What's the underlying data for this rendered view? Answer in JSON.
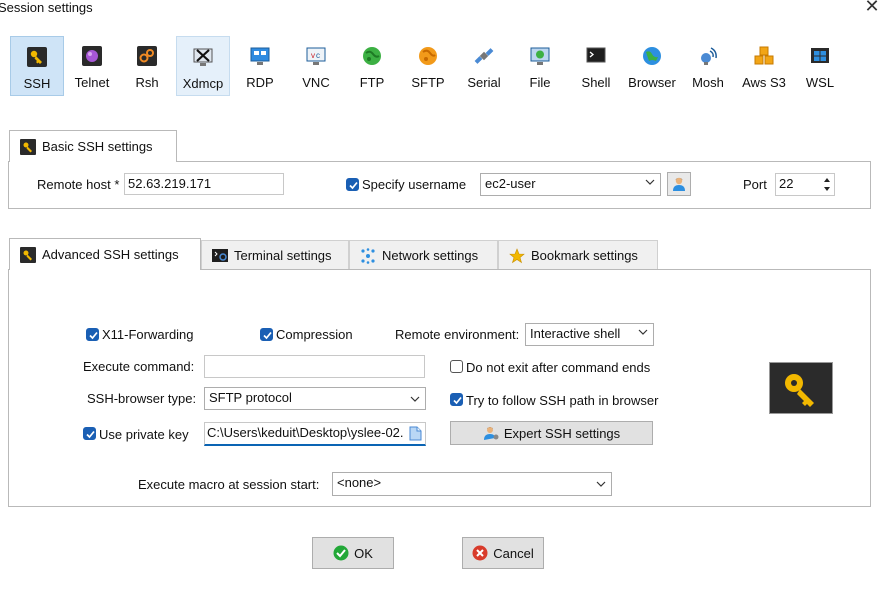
{
  "window": {
    "title": "Session settings",
    "close": "✕"
  },
  "protocols": [
    {
      "label": "SSH",
      "icon": "ssh-key-icon"
    },
    {
      "label": "Telnet",
      "icon": "telnet-icon"
    },
    {
      "label": "Rsh",
      "icon": "rsh-icon"
    },
    {
      "label": "Xdmcp",
      "icon": "xdmcp-icon"
    },
    {
      "label": "RDP",
      "icon": "rdp-monitor-icon"
    },
    {
      "label": "VNC",
      "icon": "vnc-icon"
    },
    {
      "label": "FTP",
      "icon": "ftp-globe-icon"
    },
    {
      "label": "SFTP",
      "icon": "sftp-icon"
    },
    {
      "label": "Serial",
      "icon": "serial-satellite-icon"
    },
    {
      "label": "File",
      "icon": "file-monitor-icon"
    },
    {
      "label": "Shell",
      "icon": "shell-terminal-icon"
    },
    {
      "label": "Browser",
      "icon": "browser-globe-icon"
    },
    {
      "label": "Mosh",
      "icon": "mosh-antenna-icon"
    },
    {
      "label": "Aws S3",
      "icon": "aws-s3-cubes-icon"
    },
    {
      "label": "WSL",
      "icon": "wsl-windows-icon"
    }
  ],
  "basic": {
    "tab_label": "Basic SSH settings",
    "remote_host_label": "Remote host *",
    "remote_host_value": "52.63.219.171",
    "specify_username_label": "Specify username",
    "username_value": "ec2-user",
    "port_label": "Port",
    "port_value": "22"
  },
  "advanced_tabs": [
    {
      "label": "Advanced SSH settings"
    },
    {
      "label": "Terminal settings"
    },
    {
      "label": "Network settings"
    },
    {
      "label": "Bookmark settings"
    }
  ],
  "advanced": {
    "x11_label": "X11-Forwarding",
    "compression_label": "Compression",
    "remote_env_label": "Remote environment:",
    "remote_env_value": "Interactive shell",
    "execute_command_label": "Execute command:",
    "execute_command_value": "",
    "do_not_exit_label": "Do not exit after command ends",
    "ssh_browser_type_label": "SSH-browser type:",
    "ssh_browser_type_value": "SFTP protocol",
    "follow_ssh_path_label": "Try to follow SSH path in browser",
    "use_private_key_label": "Use private key",
    "private_key_value": "C:\\Users\\keduit\\Desktop\\yslee-02.",
    "expert_button_label": "Expert SSH settings",
    "macro_label": "Execute macro at session start:",
    "macro_value": "<none>"
  },
  "footer": {
    "ok_label": "OK",
    "cancel_label": "Cancel"
  },
  "colors": {
    "accent": "#1a5fb4",
    "selected_bg": "#cfe4f7",
    "ok_green": "#22a838",
    "cancel_red": "#d83b2b"
  }
}
